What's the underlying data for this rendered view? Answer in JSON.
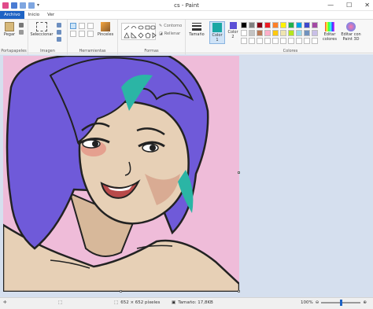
{
  "window": {
    "title": "cs - Paint",
    "controls": [
      "—",
      "☐",
      "✕"
    ]
  },
  "tabs": [
    {
      "label": "Archivo"
    },
    {
      "label": "Inicio"
    },
    {
      "label": "Ver"
    }
  ],
  "ribbon": {
    "portapapeles": {
      "label": "Portapapeles",
      "paste": "Pegar"
    },
    "imagen": {
      "label": "Imagen",
      "select": "Seleccionar"
    },
    "herramientas": {
      "label": "Herramientas",
      "brushes": "Pinceles"
    },
    "formas": {
      "label": "Formas",
      "contour": "Contorno",
      "fill": "Rellenar"
    },
    "size": {
      "label": "Tamaño"
    },
    "colors": {
      "label": "Colores",
      "color1": "Color 1",
      "color2": "Color 2",
      "edit": "Editar colores",
      "paint3d": "Editar con Paint 3D"
    }
  },
  "accent": {
    "color1": "#1aa7a4",
    "color2": "#5a4fd6",
    "file_tab": "#1e63c4"
  },
  "palette": [
    "#000000",
    "#7f7f7f",
    "#880015",
    "#ed1c24",
    "#ff7f27",
    "#fff200",
    "#22b14c",
    "#00a2e8",
    "#3f48cc",
    "#a349a4",
    "#ffffff",
    "#c3c3c3",
    "#b97a57",
    "#ffaec9",
    "#ffc90e",
    "#efe4b0",
    "#b5e61d",
    "#99d9ea",
    "#7092be",
    "#c8bfe7",
    "#ffffff",
    "#ffffff",
    "#ffffff",
    "#ffffff",
    "#ffffff",
    "#ffffff",
    "#ffffff",
    "#ffffff",
    "#ffffff",
    "#ffffff"
  ],
  "status": {
    "dimensions": "652 × 652 píxeles",
    "size": "Tamaño: 17,8KB",
    "zoom": "100%",
    "zoom_level": 0.5
  }
}
